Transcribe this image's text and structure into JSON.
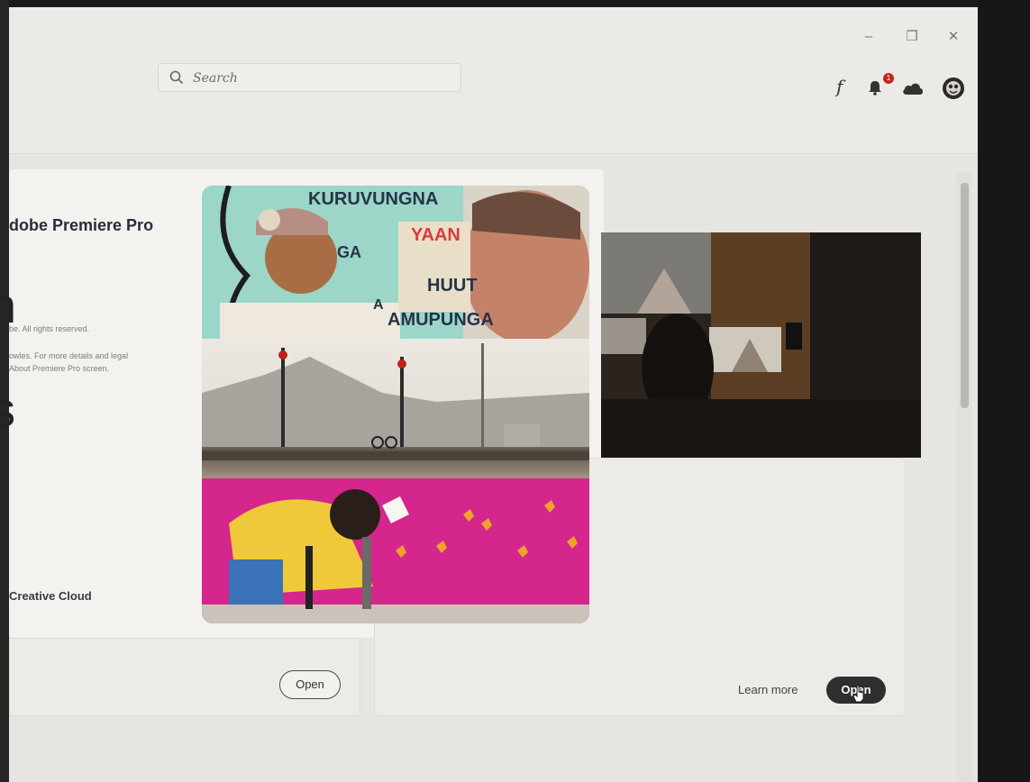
{
  "window": {
    "minimize_label": "–",
    "restore_label": "❐",
    "close_label": "✕"
  },
  "search": {
    "placeholder": "Search"
  },
  "toolbar": {
    "font_glyph": "f",
    "notification_count": "1"
  },
  "about": {
    "title": "dobe Premiere Pro",
    "copyright": "be. All rights reserved.",
    "credits_line1": "owles. For more details and legal",
    "credits_line2": "About Premiere Pro screen.",
    "creative_cloud": "Creative Cloud",
    "overlay_glyph_1": "n",
    "overlay_glyph_2": "s"
  },
  "splash": {
    "mural_word_1": "KURUVUNGNA",
    "mural_word_2": "YAAN",
    "mural_word_3": "GA",
    "mural_word_4": "HUUT",
    "mural_word_5": "AMUPUNGA",
    "mural_word_6": "A"
  },
  "cards": {
    "left_open_label": "Open",
    "learn_more_label": "Learn more",
    "right_open_label": "Open"
  },
  "colors": {
    "accent_dark": "#2f2f2f",
    "badge": "#c5261c",
    "mural_pink": "#d4268d",
    "mural_teal": "#8fd3c7"
  }
}
